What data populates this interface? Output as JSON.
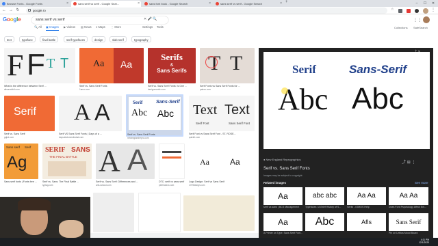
{
  "browser": {
    "tabs": [
      {
        "label": "Browse Fonts - Google Fonts",
        "icon": "google-fonts-icon",
        "color": "#4285f4"
      },
      {
        "label": "sans serif vs serif - Google Sear...",
        "icon": "google-icon",
        "color": "#ea4335"
      },
      {
        "label": "sans font book - Google Search",
        "icon": "google-icon",
        "color": "#ea4335"
      },
      {
        "label": "sans serif vs serif - Google Search",
        "icon": "google-icon",
        "color": "#ea4335"
      }
    ],
    "url": "google.ro"
  },
  "search": {
    "logo": "Google",
    "query": "sans serif vs serif",
    "nav": [
      "All",
      "Images",
      "Videos",
      "News",
      "Maps",
      "More",
      "Settings",
      "Tools"
    ],
    "right": [
      "Collections",
      "SafeSearch"
    ],
    "chips": [
      "text",
      "typeface",
      "final battle",
      "serif typefaces",
      "design",
      "slab serif",
      "typography"
    ]
  },
  "results": [
    {
      "caption": "What is the difference between Serif ...",
      "source": "alisonwiddi.com"
    },
    {
      "caption": "Serif vs. Sans Serif Fonts",
      "source": "1amo.com"
    },
    {
      "caption": "Serif vs. Sans Serif Fonts: Is One ...",
      "source": "designmantic.com"
    },
    {
      "caption": "Serif Fonts vs Sans Serif Fonts for ...",
      "source": "patreo.com"
    },
    {
      "caption": "Serif vs. Sans Serif",
      "source": "gdpd.com"
    },
    {
      "caption": "Serif VS Sans Serif Fonts | Days of a ...",
      "source": "daysofadomesticdad.com"
    },
    {
      "caption": "Serif vs. Sans Serif Fonts",
      "source": "newenglandrepro.com"
    },
    {
      "caption": "Serif Font vs Sans Serif Font - ST. ROSE...",
      "source": "quizlet.com"
    },
    {
      "caption": "Sans serif fonts | Fonts free ...",
      "source": "wikipedia.org"
    },
    {
      "caption": "Serif vs. Sans: The Final Battle ...",
      "source": "typlag.com"
    },
    {
      "caption": "Serif vs. Sans Serif: Differences and ...",
      "source": "arts-school.com"
    },
    {
      "caption": "DTC: serif vs sans serif",
      "source": "peteiratxxx.com"
    },
    {
      "caption": "Logo Design: Serif vs Sans Serif",
      "source": "1709design.com"
    }
  ],
  "tiles": {
    "t1": [
      "F",
      "F",
      "T",
      "T"
    ],
    "t2": [
      "Aa",
      "Aa"
    ],
    "t3": [
      "Serifs",
      "&",
      "Sans Serifs"
    ],
    "t5": [
      "Serif"
    ],
    "t6": [
      "A",
      "A"
    ],
    "t7": [
      "Serif",
      "Sans-Serif",
      "Abc",
      "Abc"
    ],
    "t8": [
      "Text",
      "Text",
      "Serif Font",
      "Sans Serif Font"
    ],
    "t9": [
      "Sans serif",
      "Serif",
      "Ag"
    ],
    "t10": [
      "SERIF",
      "SANS",
      "THE FINAL BATTLE"
    ],
    "t11": [
      "A",
      "A"
    ],
    "t12": [
      "Aa",
      "Aa"
    ]
  },
  "panel": {
    "source": "New England Reprographics",
    "title": "Serif vs. Sans Serif Fonts",
    "copyright": "Images may be subject to copyright.",
    "learn_more": "Learn More",
    "related": "Related images",
    "see_more": "See more",
    "preview": {
      "serif": "Serif",
      "sans": "Sans-Serif",
      "abc": "Abc"
    },
    "related_items": [
      {
        "title": "serif vs sans | BCS Management",
        "img": "Aa"
      },
      {
        "title": "Typefaces / A Brief History of S...",
        "img": "abc abc"
      },
      {
        "title": "Serifs - IOMOS Help",
        "img": "Aa Aa"
      },
      {
        "title": "Does Font Psychology Affect Em...",
        "img": "Aa Aa"
      },
      {
        "title": "A Primer on Type: Sans Serif Font...",
        "img": "Aa"
      },
      {
        "title": "",
        "img": "Abc"
      },
      {
        "title": "",
        "img": "Afls"
      },
      {
        "title": "Pin on Lettius Mood Board",
        "img": "Sans Serif"
      }
    ]
  },
  "taskbar": {
    "time": "4:11 PM",
    "date": "12/1/2020"
  },
  "colors": {
    "blue": "#1a73e8",
    "orange": "#f06a35",
    "red": "#c0392b",
    "navy": "#1f3f8a"
  }
}
